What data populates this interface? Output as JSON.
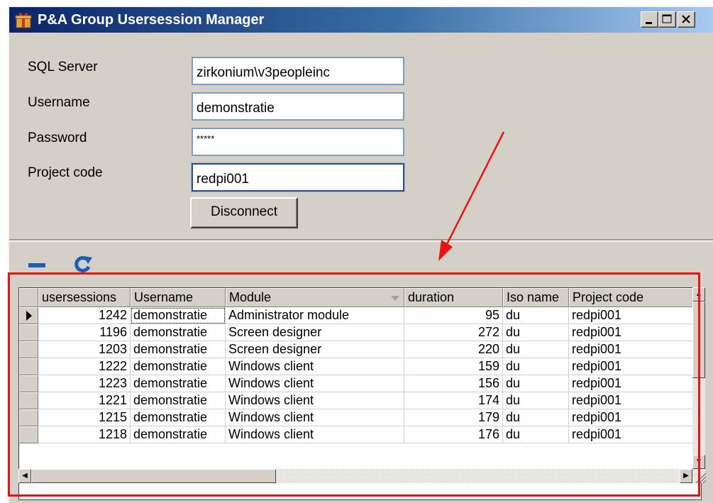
{
  "window": {
    "title": "P&A Group Usersession Manager"
  },
  "form": {
    "sql_server_label": "SQL Server",
    "sql_server_value": "zirkonium\\v3peopleinc",
    "username_label": "Username",
    "username_value": "demonstratie",
    "password_label": "Password",
    "password_value": "*****",
    "project_code_label": "Project code",
    "project_code_value": "redpi001",
    "disconnect_label": "Disconnect"
  },
  "toolbar": {
    "delete_icon": "minus-icon",
    "refresh_icon": "refresh-icon"
  },
  "grid": {
    "columns": [
      "usersessions",
      "Username",
      "Module",
      "duration",
      "Iso name",
      "Project code"
    ],
    "rows": [
      [
        "1242",
        "demonstratie",
        "Administrator module",
        "95",
        "du",
        "redpi001"
      ],
      [
        "1196",
        "demonstratie",
        "Screen designer",
        "272",
        "du",
        "redpi001"
      ],
      [
        "1203",
        "demonstratie",
        "Screen designer",
        "220",
        "du",
        "redpi001"
      ],
      [
        "1222",
        "demonstratie",
        "Windows client",
        "159",
        "du",
        "redpi001"
      ],
      [
        "1223",
        "demonstratie",
        "Windows client",
        "156",
        "du",
        "redpi001"
      ],
      [
        "1221",
        "demonstratie",
        "Windows client",
        "174",
        "du",
        "redpi001"
      ],
      [
        "1215",
        "demonstratie",
        "Windows client",
        "179",
        "du",
        "redpi001"
      ],
      [
        "1218",
        "demonstratie",
        "Windows client",
        "176",
        "du",
        "redpi001"
      ]
    ]
  },
  "colors": {
    "annotation": "#ee1111",
    "title_gradient_start": "#0a246a",
    "title_gradient_end": "#a6caf0"
  }
}
